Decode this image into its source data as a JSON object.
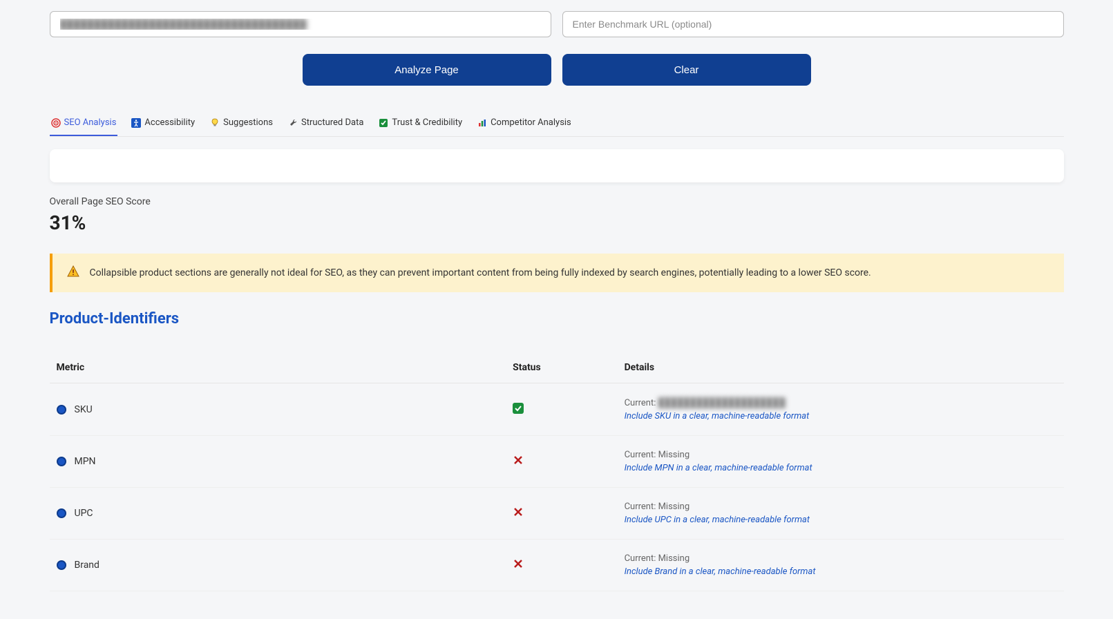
{
  "inputs": {
    "url_value": "",
    "benchmark_placeholder": "Enter Benchmark URL (optional)"
  },
  "buttons": {
    "analyze": "Analyze Page",
    "clear": "Clear"
  },
  "tabs": [
    {
      "label": "SEO Analysis",
      "active": true
    },
    {
      "label": "Accessibility",
      "active": false
    },
    {
      "label": "Suggestions",
      "active": false
    },
    {
      "label": "Structured Data",
      "active": false
    },
    {
      "label": "Trust & Credibility",
      "active": false
    },
    {
      "label": "Competitor Analysis",
      "active": false
    }
  ],
  "score": {
    "label": "Overall Page SEO Score",
    "value": "31%"
  },
  "alert": {
    "text": "Collapsible product sections are generally not ideal for SEO, as they can prevent important content from being fully indexed by search engines, potentially leading to a lower SEO score."
  },
  "section": {
    "title": "Product-Identifiers"
  },
  "table": {
    "headers": {
      "metric": "Metric",
      "status": "Status",
      "details": "Details"
    },
    "rows": [
      {
        "metric": "SKU",
        "status": "ok",
        "current_label": "Current:",
        "current_value": "",
        "current_blurred": true,
        "suggestion": "Include SKU in a clear, machine-readable format"
      },
      {
        "metric": "MPN",
        "status": "fail",
        "current_label": "Current:",
        "current_value": "Missing",
        "current_blurred": false,
        "suggestion": "Include MPN in a clear, machine-readable format"
      },
      {
        "metric": "UPC",
        "status": "fail",
        "current_label": "Current:",
        "current_value": "Missing",
        "current_blurred": false,
        "suggestion": "Include UPC in a clear, machine-readable format"
      },
      {
        "metric": "Brand",
        "status": "fail",
        "current_label": "Current:",
        "current_value": "Missing",
        "current_blurred": false,
        "suggestion": "Include Brand in a clear, machine-readable format"
      }
    ]
  }
}
